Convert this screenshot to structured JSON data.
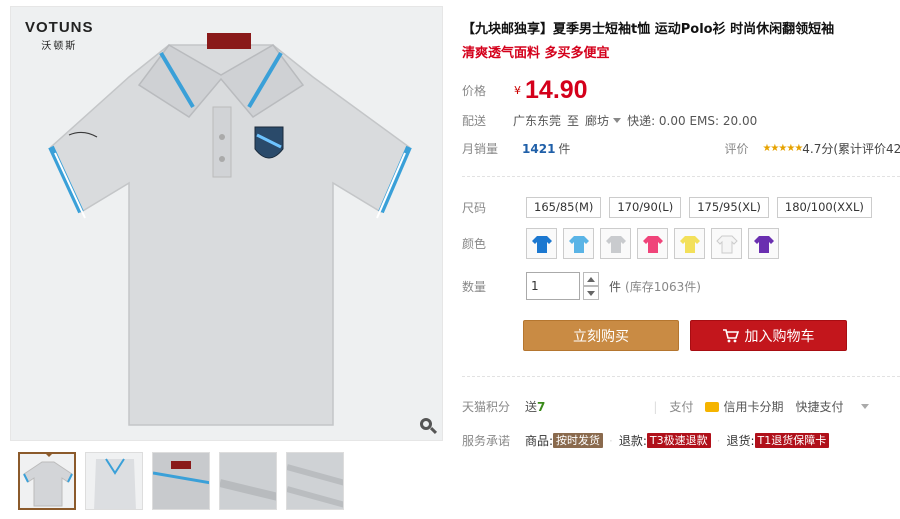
{
  "brand": {
    "name_en": "VOTUNS",
    "name_cn": "沃顿斯"
  },
  "title": "【九块邮独享】夏季男士短袖t恤 运动Polo衫 时尚休闲翻领短袖",
  "subtitle": "清爽透气面料 多买多便宜",
  "price": {
    "label": "价格",
    "currency": "¥",
    "value": "14.90"
  },
  "shipping": {
    "label": "配送",
    "from": "广东东莞",
    "to_word": "至",
    "to": "廊坊",
    "fees": "快递: 0.00 EMS: 20.00"
  },
  "sales": {
    "label": "月销量",
    "count": "1421",
    "unit": "件"
  },
  "review": {
    "label": "评价",
    "stars": "★★★★★",
    "text": "4.7分(累计评价42"
  },
  "size": {
    "label": "尺码",
    "options": [
      "165/85(M)",
      "170/90(L)",
      "175/95(XL)",
      "180/100(XXL)"
    ]
  },
  "color": {
    "label": "颜色",
    "swatches": [
      {
        "name": "blue",
        "hex": "#1c78d0"
      },
      {
        "name": "light-blue",
        "hex": "#5ab4e6"
      },
      {
        "name": "grey",
        "hex": "#c9cbce"
      },
      {
        "name": "pink",
        "hex": "#f0447a"
      },
      {
        "name": "yellow",
        "hex": "#f3e05a"
      },
      {
        "name": "white",
        "hex": "#f5f5f5"
      },
      {
        "name": "purple",
        "hex": "#6a2fb0"
      }
    ]
  },
  "quantity": {
    "label": "数量",
    "value": "1",
    "unit": "件",
    "stock": "(库存1063件)"
  },
  "buttons": {
    "buy": "立刻购买",
    "cart": "加入购物车"
  },
  "points": {
    "label": "天猫积分",
    "prefix": "送",
    "value": "7"
  },
  "payment": {
    "label": "支付",
    "credit": "信用卡分期",
    "quick": "快捷支付"
  },
  "service": {
    "label": "服务承诺",
    "items": [
      {
        "prefix": "商品:",
        "badge": "按时发货"
      },
      {
        "prefix": "退款:",
        "badge": "T3极速退款"
      },
      {
        "prefix": "退货:",
        "badge": "T1退货保障卡"
      }
    ]
  },
  "colors": {
    "price_red": "#d4001b",
    "buy_orange": "#c98b44",
    "cart_red": "#c3161c",
    "link_blue": "#1f5fa8"
  }
}
